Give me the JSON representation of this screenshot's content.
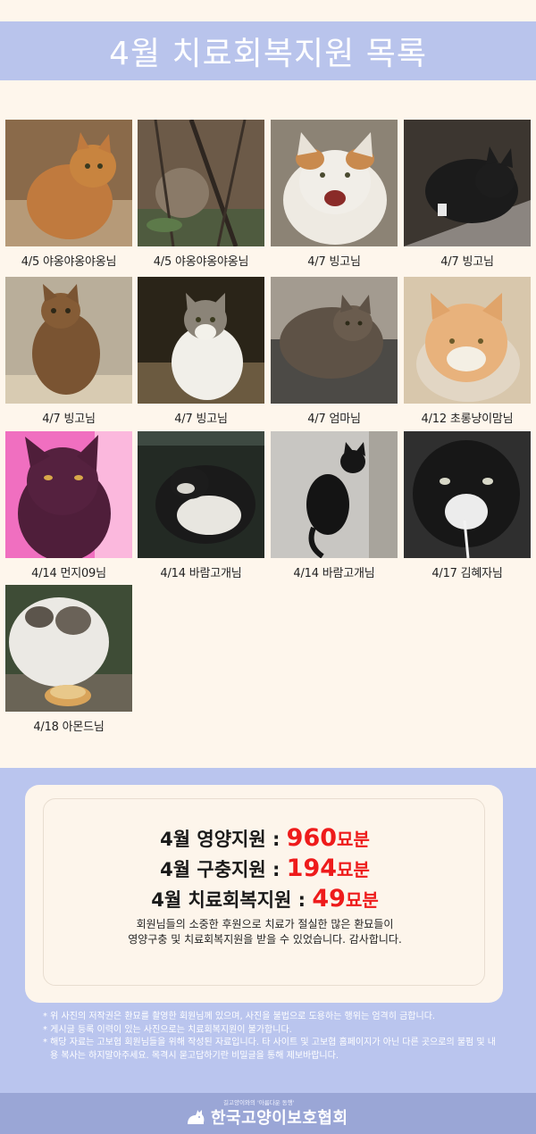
{
  "title": "4월 치료회복지원 목록",
  "cats": [
    {
      "caption": "4/5 야옹야옹야옹님"
    },
    {
      "caption": "4/5 야옹야옹야옹님"
    },
    {
      "caption": "4/7 빙고님"
    },
    {
      "caption": "4/7 빙고님"
    },
    {
      "caption": "4/7 빙고님"
    },
    {
      "caption": "4/7 빙고님"
    },
    {
      "caption": "4/7 엄마님"
    },
    {
      "caption": "4/12 초롱냥이맘님"
    },
    {
      "caption": "4/14 먼지09님"
    },
    {
      "caption": "4/14 바람고개님"
    },
    {
      "caption": "4/14 바람고개님"
    },
    {
      "caption": "4/17 김혜자님"
    },
    {
      "caption": "4/18 아몬드님"
    }
  ],
  "summary": {
    "stats": [
      {
        "label": "4월 영양지원 : ",
        "value": "960",
        "unit": "묘분"
      },
      {
        "label": "4월 구충지원 : ",
        "value": "194",
        "unit": "묘분"
      },
      {
        "label": "4월 치료회복지원 : ",
        "value": "49",
        "unit": "묘분"
      }
    ],
    "thanks_line1": "회원님들의 소중한 후원으로 치료가 절실한 많은 환묘들이",
    "thanks_line2": "영양구충 및 치료회복지원을 받을 수 있었습니다. 감사합니다."
  },
  "notes": [
    "* 위 사진의 저작권은 환묘를 촬영한 회원님께 있으며, 사진을 불법으로 도용하는 행위는 엄격히 금합니다.",
    "* 게시글 등록 이력이 있는 사진으로는 치료회복지원이 불가합니다.",
    "* 해당 자료는 고보협 회원님들을 위해 작성된 자료입니다. 타 사이트 및 고보협 홈페이지가 아닌 다른 곳으로의 불펌 및 내용 복사는 하지말아주세요. 목격시 묻고답하기란 비밀글을 통해 제보바랍니다."
  ],
  "footer": {
    "tagline": "길고양이와의 '아름다운 동행'",
    "org_name": "한국고양이보호협회",
    "logo_icon": "cat-silhouette-icon"
  },
  "colors": {
    "accent_band": "#b9c4ec",
    "background": "#fef6ec",
    "highlight": "#ee1b1b",
    "footer": "#9aa6d6"
  }
}
